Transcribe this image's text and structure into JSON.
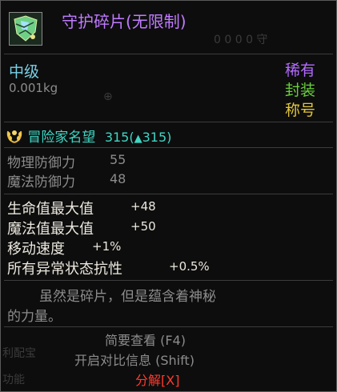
{
  "colors": {
    "title": "#c07bff",
    "grade": "#78d0e6",
    "rarity": "#b36bff",
    "sealed": "#68cf3a",
    "title_type": "#e0c63c",
    "fame": "#3fd6c4",
    "remove": "#ff3a2e"
  },
  "item": {
    "icon": "cracked-green-shield-fragment-icon",
    "title": "守护碎片(无限制)",
    "grade": "中级",
    "weight": "0.001kg",
    "rarity": "稀有",
    "sealed": "封装",
    "type": "称号"
  },
  "fame": {
    "icon": "laurel-wreath-icon",
    "label": "冒险家名望",
    "value": "315(",
    "arrow": "▲",
    "delta": "315)"
  },
  "defense": [
    {
      "label": "物理防御力",
      "value": "55"
    },
    {
      "label": "魔法防御力",
      "value": "48"
    }
  ],
  "stats": [
    {
      "label": "生命值最大值",
      "value": "+48"
    },
    {
      "label": "魔法值最大值",
      "value": "+50"
    },
    {
      "label": "移动速度",
      "value": "+1%"
    },
    {
      "label": "所有异常状态抗性",
      "value": "+0.5%"
    }
  ],
  "flavor": {
    "line1": "虽然是碎片，但是蕴含着神秘",
    "line2": "的力量。"
  },
  "footer": {
    "brief": "简要查看 (F4)",
    "compare": "开启对比信息 (Shift)",
    "disassemble": "分解[X]"
  }
}
